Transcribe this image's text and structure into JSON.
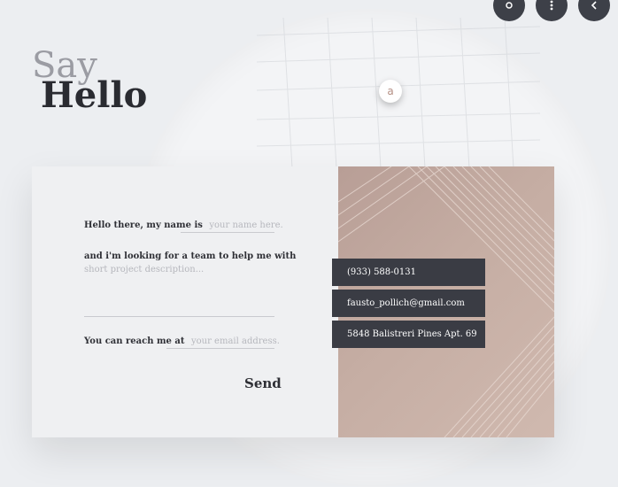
{
  "title": {
    "line1": "Say",
    "line2": "Hello"
  },
  "form": {
    "name_prefix": "Hello there, my name is",
    "name_placeholder": "your name here.",
    "project_prefix": "and i'm looking for a team to help me with",
    "project_placeholder": "short project description...",
    "email_prefix": "You can reach me at",
    "email_placeholder": "your email address.",
    "send_label": "Send"
  },
  "contact": {
    "phone": "(933) 588-0131",
    "email": "fausto_pollich@gmail.com",
    "address": "5848 Balistreri Pines Apt. 69"
  },
  "map_pin_label": "a",
  "colors": {
    "accent": "#c4ab9f",
    "dark": "#3a3c44",
    "background": "#eceef1"
  },
  "icons": {
    "top_right": [
      "lens-icon",
      "more-vertical-icon",
      "chevron-left-icon"
    ]
  }
}
